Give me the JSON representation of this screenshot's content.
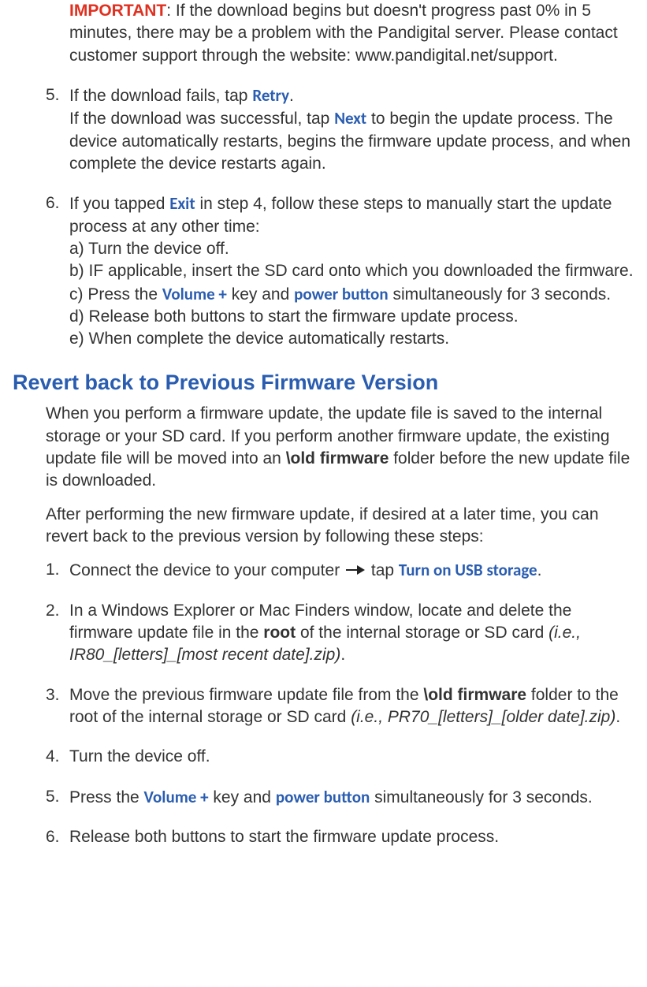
{
  "step4_important": {
    "label": "IMPORTANT",
    "text": ": If the download begins but doesn't progress past 0% in 5 minutes, there may be a problem with the Pandigital server. Please contact customer support through the website: www.pandigital.net/support."
  },
  "step5": {
    "num": "5.",
    "line1a": "If the download fails, tap ",
    "retry": "Retry",
    "line1b": ".",
    "line2a": "If the download was successful, tap ",
    "next": "Next",
    "line2b": " to begin the update process. The device automatically restarts, begins the firmware update process, and when complete the device restarts again."
  },
  "step6": {
    "num": "6.",
    "intro_a": "If you tapped ",
    "exit": "Exit",
    "intro_b": " in step 4, follow these steps to manually start the update process at any other time:",
    "a": "a) Turn the device off.",
    "b": "b) IF applicable, insert the SD card onto which you downloaded the firmware.",
    "c_a": "c) Press the ",
    "volplus": "Volume +",
    "c_b": " key and ",
    "powerbtn": "power button",
    "c_c": " simultaneously for 3 seconds.",
    "d": "d) Release both buttons to start the firmware update process.",
    "e": "e) When complete the device automatically restarts."
  },
  "revert": {
    "heading": "Revert back to Previous Firmware Version",
    "p1_a": "When you perform a firmware update, the update file is saved to the internal storage or your SD card. If you perform another firmware update, the existing update file will be moved into an ",
    "old_fw": "\\old firmware",
    "p1_b": " folder before the new update file is downloaded.",
    "p2": "After performing the new firmware update, if desired at a later time, you can revert back to the previous version by following these steps:"
  },
  "rsteps": {
    "s1": {
      "num": "1.",
      "a": "Connect the device to your computer ",
      "usb": "Turn on USB storage",
      "b": " tap ",
      "c": "."
    },
    "s2": {
      "num": "2.",
      "a": "In a Windows Explorer or Mac Finders window, locate and delete the firmware update file in the ",
      "root": "root",
      "b": " of the internal storage or SD card ",
      "ex": "(i.e., IR80_[letters]_[most recent date].zip)",
      "c": "."
    },
    "s3": {
      "num": "3.",
      "a": "Move the previous firmware update file from the ",
      "old_fw": "\\old firmware",
      "b": " folder to the root of the internal storage or SD card ",
      "ex": "(i.e., PR70_[letters]_[older date].zip)",
      "c": "."
    },
    "s4": {
      "num": "4.",
      "a": "Turn the device off."
    },
    "s5": {
      "num": "5.",
      "a": "Press the ",
      "volplus": "Volume +",
      "b": " key and ",
      "powerbtn": "power button",
      "c": " simultaneously for 3 seconds."
    },
    "s6": {
      "num": "6.",
      "a": "Release both buttons to start the firmware update process."
    }
  }
}
